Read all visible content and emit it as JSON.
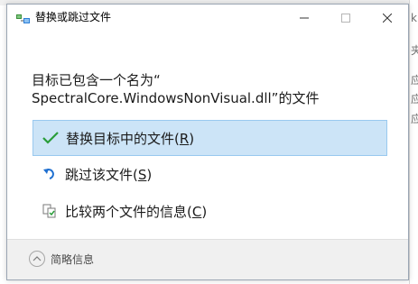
{
  "background": {
    "right_text": [
      "k",
      "夹",
      "应",
      "应",
      "应"
    ],
    "top_text": [
      "(",
      "(",
      "("
    ]
  },
  "dialog": {
    "title": "替换或跳过文件",
    "window_buttons": {
      "minimize": "minimize-icon",
      "maximize": "maximize-icon",
      "close": "close-icon"
    },
    "heading_line1": "目标已包含一个名为“",
    "heading_line2": "SpectralCore.WindowsNonVisual.dll”的文件",
    "options": [
      {
        "icon": "checkmark-icon",
        "label": "替换目标中的文件(",
        "accelerator": "R",
        "suffix": ")",
        "selected": true
      },
      {
        "icon": "skip-arrow-icon",
        "label": "跳过该文件(",
        "accelerator": "S",
        "suffix": ")",
        "selected": false
      },
      {
        "icon": "compare-files-icon",
        "label": "比较两个文件的信息(",
        "accelerator": "C",
        "suffix": ")",
        "selected": false
      }
    ],
    "footer": {
      "details_label": "简略信息",
      "details_icon": "chevron-up-icon"
    },
    "colors": {
      "selected_bg": "#cce4f7",
      "selected_border": "#99c9ef",
      "check_green": "#2a9d3a",
      "skip_blue": "#1e6fd0"
    }
  }
}
